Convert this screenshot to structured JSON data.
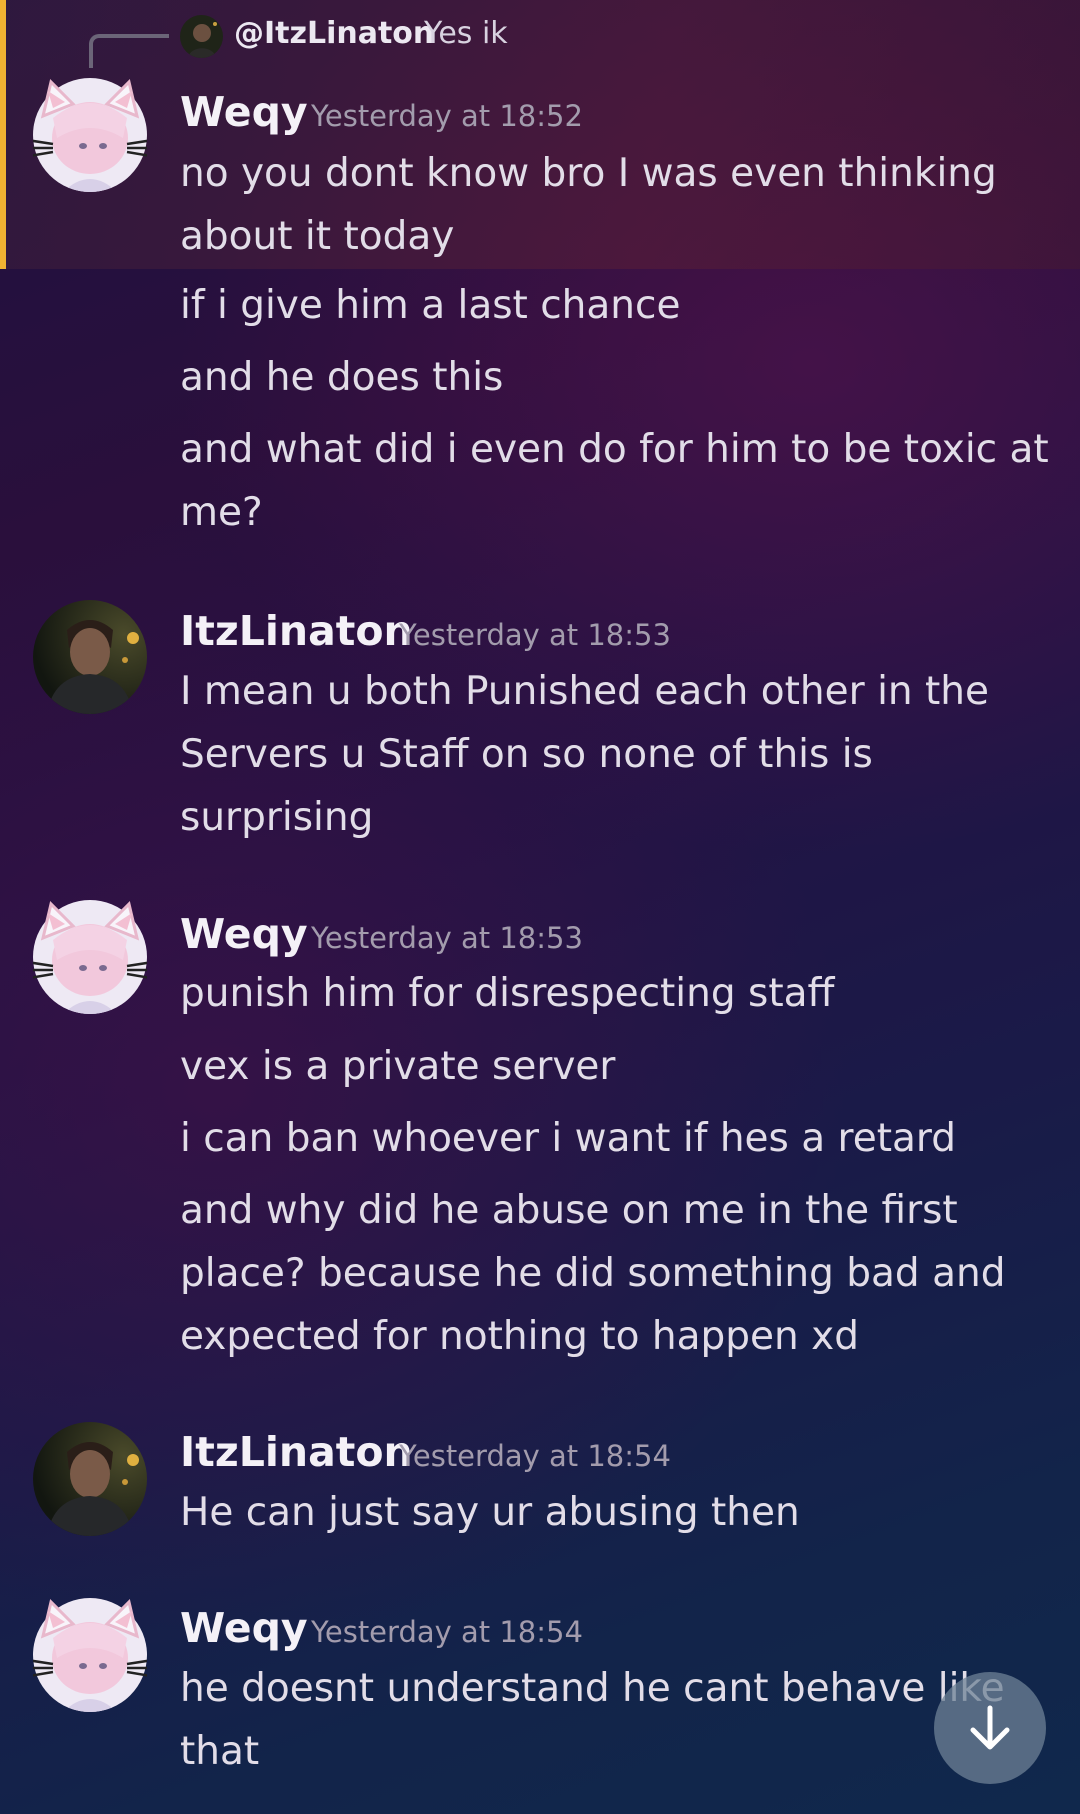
{
  "reply": {
    "name": "@ItzLinaton",
    "text": "Yes ik"
  },
  "messages": [
    {
      "user": "Weqy",
      "time": "Yesterday at 18:52",
      "lines": [
        "no you dont know bro I was even thinking",
        "about it today",
        "if i give him a last chance",
        "and he does this",
        "and what did i even do for him to be toxic at",
        "me?"
      ]
    },
    {
      "user": "ItzLinaton",
      "time": "Yesterday at 18:53",
      "lines": [
        "I mean u both Punished each other in the",
        "Servers u Staff on so none of this is",
        "surprising"
      ]
    },
    {
      "user": "Weqy",
      "time": "Yesterday at 18:53",
      "lines": [
        "punish him for disrespecting staff",
        "vex is a private server",
        "i can ban whoever i want if hes a retard",
        "and why did he abuse on me in the first",
        "place? because he did something bad and",
        "expected for nothing to happen xd"
      ]
    },
    {
      "user": "ItzLinaton",
      "time": "Yesterday at 18:54",
      "lines": [
        "He can just say ur abusing then"
      ]
    },
    {
      "user": "Weqy",
      "time": "Yesterday at 18:54",
      "lines": [
        "he doesnt understand he cant behave like",
        "that"
      ]
    }
  ],
  "icons": {
    "scroll_down": "arrow-down-icon"
  },
  "colors": {
    "highlight_bar": "#f0b232"
  }
}
